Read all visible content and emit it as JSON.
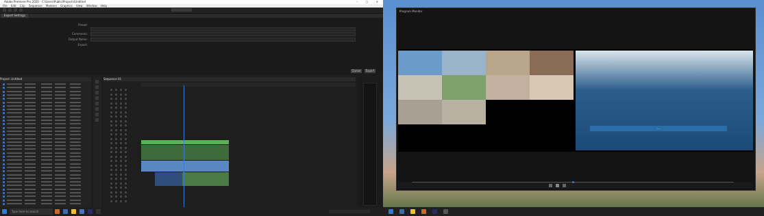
{
  "left_window": {
    "title": "Adobe Premiere Pro 2020 - C:\\Users\\Public\\Projects\\Untitled",
    "menu": [
      "File",
      "Edit",
      "Clip",
      "Sequence",
      "Markers",
      "Graphics",
      "View",
      "Window",
      "Help"
    ],
    "tab": "Export Settings",
    "dialog_labels": [
      "Preset:",
      "Comments:",
      "Output Name:",
      "Export:"
    ],
    "dialog_buttons": [
      "Queue",
      "Export"
    ],
    "project_panel_title": "Project: Untitled",
    "timeline_title": "Sequence 01"
  },
  "right_window": {
    "title": "Program Monitor",
    "caption_text": "..."
  },
  "taskbar": {
    "search_placeholder": "Type here to search"
  },
  "colors": {
    "accent_blue": "#3d6fb5",
    "clip_green": "#59b352",
    "clip_blue": "#5a86c2"
  }
}
